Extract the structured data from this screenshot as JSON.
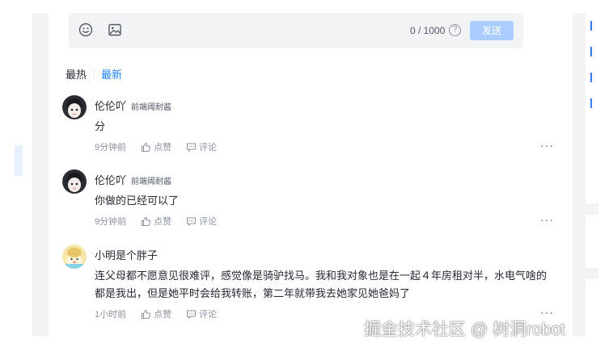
{
  "editor": {
    "counter": "0 / 1000",
    "send_label": "发送",
    "help_glyph": "?"
  },
  "tabs": {
    "hot": "最热",
    "new": "最新"
  },
  "comments": [
    {
      "name": "伦伦吖",
      "tag": "前端阈耐酱",
      "body": "分",
      "time": "9分钟前",
      "like": "点赞",
      "reply": "评论",
      "more": "···"
    },
    {
      "name": "伦伦吖",
      "tag": "前端阈耐酱",
      "body": "你做的已经可以了",
      "time": "9分钟前",
      "like": "点赞",
      "reply": "评论",
      "more": "···"
    },
    {
      "name": "小明是个胖子",
      "body": "连父母都不愿意见很难评，感觉像是骑驴找马。我和我对象也是在一起４年房租对半，水电气啥的都是我出，但是她平时会给我转账，第二年就带我去她家见她爸妈了",
      "time": "1小时前",
      "like": "点赞",
      "reply": "评论",
      "more": "···"
    }
  ],
  "watermark": "掘金技术社区 @ 树洞robot",
  "colors": {
    "accent": "#1e80ff",
    "send_disabled": "#abcdff",
    "muted": "#8a919f"
  }
}
